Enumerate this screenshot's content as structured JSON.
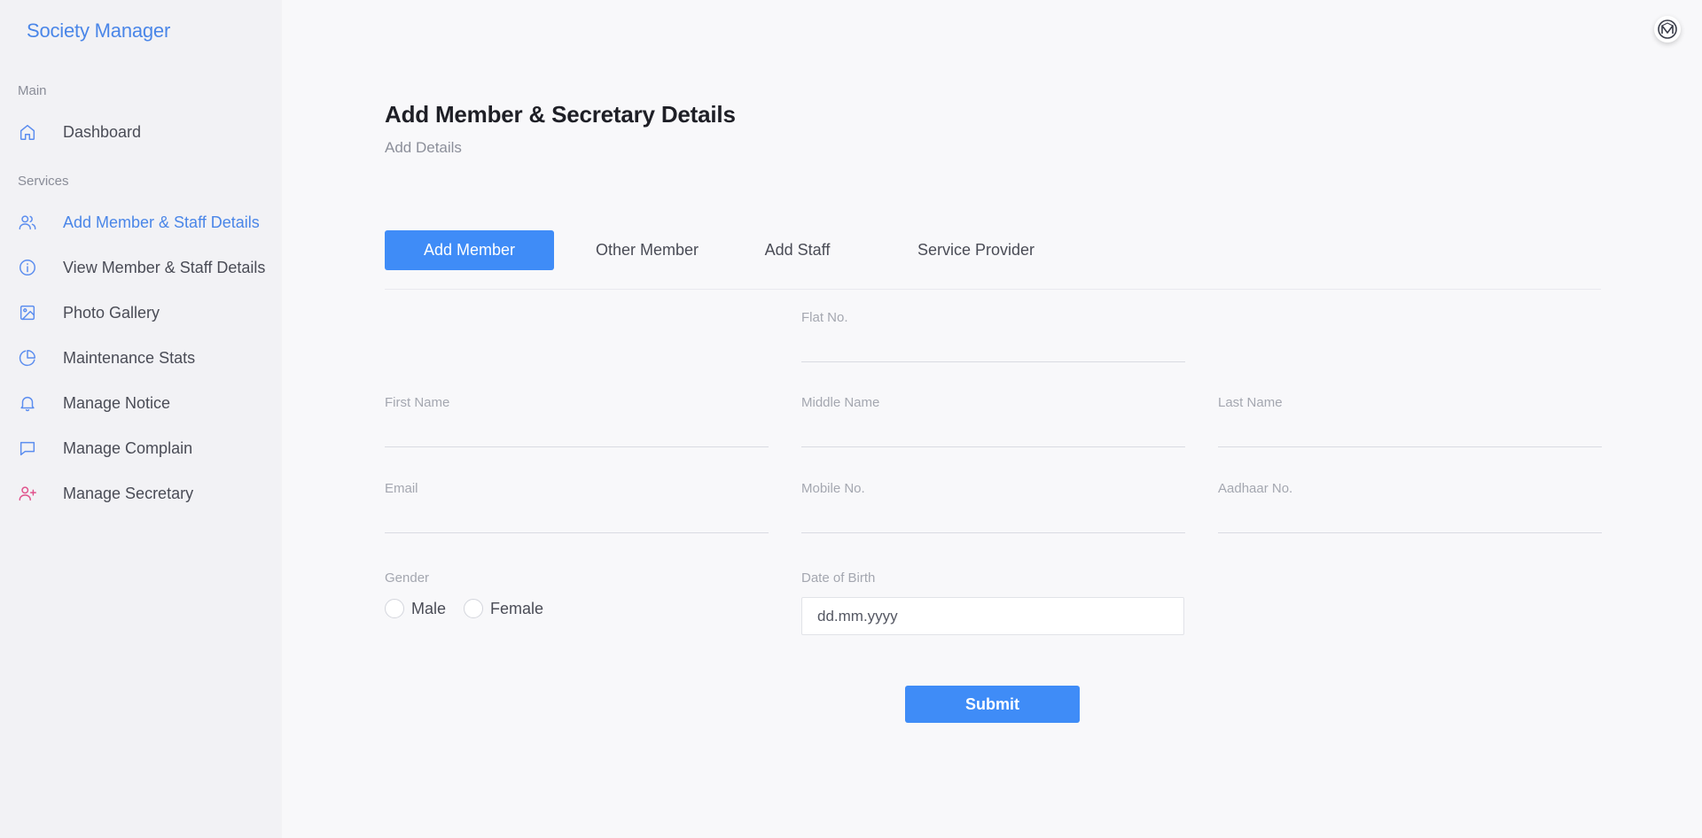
{
  "brand": "Society Manager",
  "sidebar": {
    "sections": [
      {
        "label": "Main"
      },
      {
        "label": "Services"
      }
    ],
    "items": [
      {
        "label": "Dashboard",
        "icon": "home-icon"
      },
      {
        "label": "Add Member & Staff Details",
        "icon": "users-icon",
        "active": true
      },
      {
        "label": "View Member & Staff Details",
        "icon": "info-icon"
      },
      {
        "label": "Photo Gallery",
        "icon": "image-icon"
      },
      {
        "label": "Maintenance Stats",
        "icon": "pie-chart-icon"
      },
      {
        "label": "Manage Notice",
        "icon": "bell-icon"
      },
      {
        "label": "Manage Complain",
        "icon": "message-icon"
      },
      {
        "label": "Manage Secretary",
        "icon": "user-plus-icon"
      }
    ]
  },
  "header": {
    "title": "Add Member & Secretary Details",
    "subtitle": "Add Details"
  },
  "tabs": [
    {
      "label": "Add Member",
      "active": true
    },
    {
      "label": "Other Member"
    },
    {
      "label": "Add Staff"
    },
    {
      "label": "Service Provider"
    }
  ],
  "form": {
    "flat_no": {
      "label": "Flat No.",
      "value": ""
    },
    "first_name": {
      "label": "First Name",
      "value": ""
    },
    "middle_name": {
      "label": "Middle Name",
      "value": ""
    },
    "last_name": {
      "label": "Last Name",
      "value": ""
    },
    "email": {
      "label": "Email",
      "value": ""
    },
    "mobile_no": {
      "label": "Mobile No.",
      "value": ""
    },
    "aadhaar_no": {
      "label": "Aadhaar No.",
      "value": ""
    },
    "gender": {
      "label": "Gender",
      "options": [
        "Male",
        "Female"
      ]
    },
    "dob": {
      "label": "Date of Birth",
      "placeholder": "dd.mm.yyyy"
    },
    "submit_label": "Submit"
  },
  "colors": {
    "accent": "#3f8cf7",
    "brand": "#4a86e8",
    "secretary_icon": "#e0528c"
  }
}
